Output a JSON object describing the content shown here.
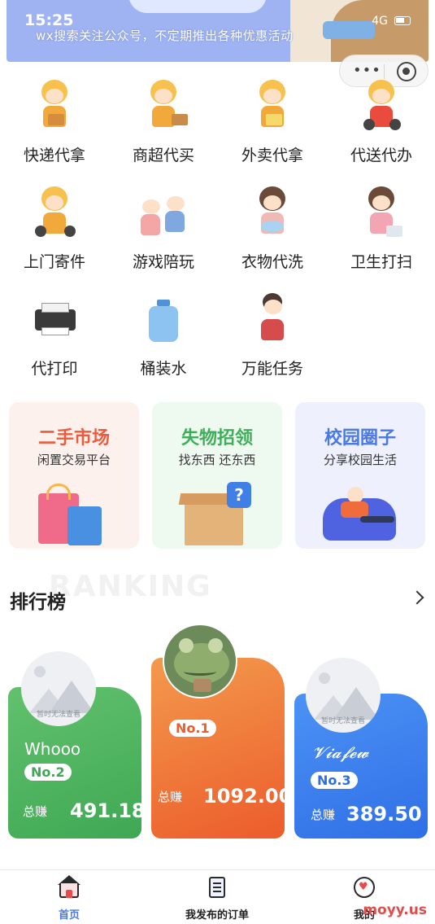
{
  "status": {
    "time": "15:25",
    "network": "4G"
  },
  "banner": {
    "text": "wx搜索关注公众号，不定期推出各种优惠活动"
  },
  "services": [
    {
      "label": "快递代拿",
      "icon": "courier-pickup-icon"
    },
    {
      "label": "商超代买",
      "icon": "supermarket-buy-icon"
    },
    {
      "label": "外卖代拿",
      "icon": "takeout-pickup-icon"
    },
    {
      "label": "代送代办",
      "icon": "delivery-errand-icon"
    },
    {
      "label": "上门寄件",
      "icon": "door-shipping-icon"
    },
    {
      "label": "游戏陪玩",
      "icon": "game-companion-icon"
    },
    {
      "label": "衣物代洗",
      "icon": "laundry-icon"
    },
    {
      "label": "卫生打扫",
      "icon": "cleaning-icon"
    },
    {
      "label": "代打印",
      "icon": "printer-icon"
    },
    {
      "label": "桶装水",
      "icon": "water-bottle-icon"
    },
    {
      "label": "万能任务",
      "icon": "universal-task-icon"
    }
  ],
  "promos": [
    {
      "title": "二手市场",
      "subtitle": "闲置交易平台",
      "color": "#ef5a3c",
      "bg": "#fdf1ee"
    },
    {
      "title": "失物招领",
      "subtitle": "找东西 还东西",
      "color": "#3fae5a",
      "bg": "#eef9f0"
    },
    {
      "title": "校园圈子",
      "subtitle": "分享校园生活",
      "color": "#4a78e6",
      "bg": "#eef1fd"
    }
  ],
  "ranking": {
    "title": "排行榜",
    "watermark": "RANKING",
    "earn_label": "总赚",
    "placeholder_caption": "暂时无法查看",
    "entries": [
      {
        "rank": "No.2",
        "name": "Whooo",
        "amount": "491.18",
        "color": "#4fb55f"
      },
      {
        "rank": "No.1",
        "name": "",
        "amount": "1092.00",
        "color": "#f07d3c"
      },
      {
        "rank": "No.3",
        "name": "𝓥𝓲𝓪𝓯𝓮𝔀",
        "amount": "389.50",
        "color": "#3d7ef0"
      }
    ]
  },
  "tabs": [
    {
      "label": "首页",
      "icon": "home-icon",
      "active": true
    },
    {
      "label": "我发布的订单",
      "icon": "order-list-icon",
      "active": false
    },
    {
      "label": "我的",
      "icon": "profile-icon",
      "active": false
    }
  ],
  "site_watermark": "moyy.us"
}
